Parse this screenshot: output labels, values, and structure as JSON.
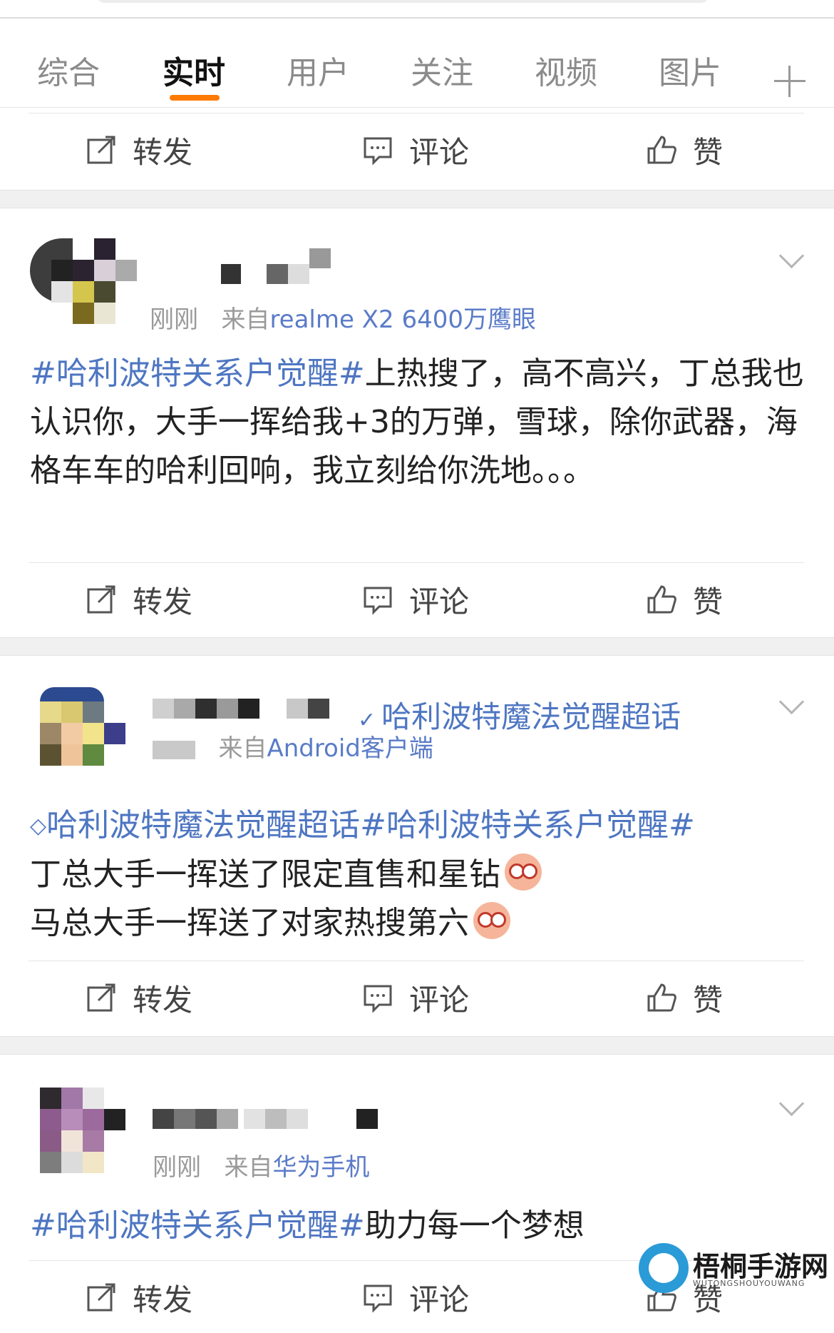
{
  "tabs": [
    {
      "label": "综合"
    },
    {
      "label": "实时",
      "active": true
    },
    {
      "label": "用户"
    },
    {
      "label": "关注"
    },
    {
      "label": "视频"
    },
    {
      "label": "图片"
    }
  ],
  "actions": {
    "repost": "转发",
    "comment": "评论",
    "like": "赞"
  },
  "posts": [
    {
      "time": "刚刚",
      "source_prefix": "来自",
      "source": "realme X2 6400万鹰眼",
      "hashtag": "#哈利波特关系户觉醒#",
      "text": "上热搜了，高不高兴，丁总我也认识你，大手一挥给我+3的万弹，雪球，除你武器，海格车车的哈利回响，我立刻给你洗地。。。"
    },
    {
      "topic_link": "哈利波特魔法觉醒超话",
      "source_prefix": "来自",
      "source": "Android客户端",
      "supertopic": "哈利波特魔法觉醒超话",
      "hashtag": "#哈利波特关系户觉醒#",
      "line1": "丁总大手一挥送了限定直售和星钻",
      "line2": "马总大手一挥送了对家热搜第六"
    },
    {
      "time": "刚刚",
      "source_prefix": "来自",
      "source": "华为手机",
      "hashtag": "#哈利波特关系户觉醒#",
      "text": "助力每一个梦想"
    }
  ],
  "watermark": {
    "title": "梧桐手游网",
    "subtitle": "WUTONGSHOUYOUWANG"
  },
  "colors": {
    "accent": "#ff7a00",
    "link": "#4e76c2",
    "source": "#5a7bc8"
  }
}
